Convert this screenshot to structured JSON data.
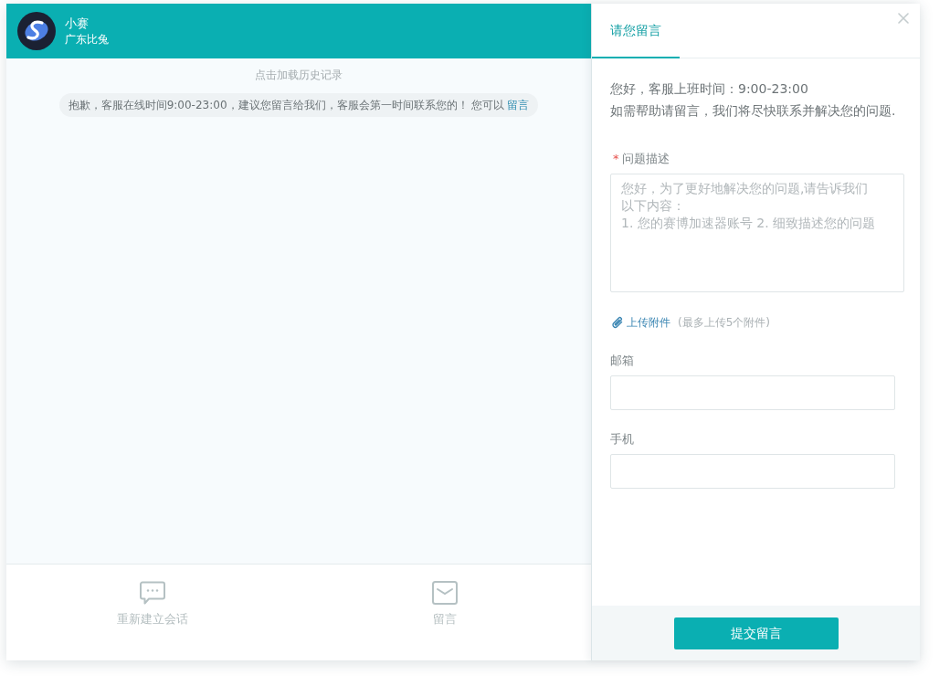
{
  "chat": {
    "agent": {
      "name": "小赛",
      "subtitle": "广东比兔"
    },
    "history_link": "点击加载历史记录",
    "notice": {
      "text": "抱歉，客服在线时间9:00-23:00，建议您留言给我们，客服会第一时间联系您的！ 您可以",
      "link": "留言"
    },
    "actions": [
      {
        "kind": "chat",
        "label": "重新建立会话"
      },
      {
        "kind": "mail",
        "label": "留言"
      }
    ]
  },
  "message_panel": {
    "tabs": [
      {
        "label": "请您留言",
        "selected": true
      }
    ],
    "intro": [
      "您好，客服上班时间：9:00-23:00",
      "如需帮助请留言，我们将尽快联系并解决您的问题."
    ],
    "fields": [
      {
        "kind": "textarea",
        "required_mark": "*",
        "label": "问题描述",
        "placeholder": "您好，为了更好地解决您的问题,请告诉我们以下内容：\n1. 您的赛博加速器账号 2. 细致描述您的问题"
      },
      {
        "kind": "upload",
        "label": "上传附件",
        "hint": "(最多上传5个附件)"
      },
      {
        "kind": "input",
        "label": "邮箱"
      },
      {
        "kind": "input",
        "label": "手机"
      }
    ],
    "submit": "提交留言"
  }
}
